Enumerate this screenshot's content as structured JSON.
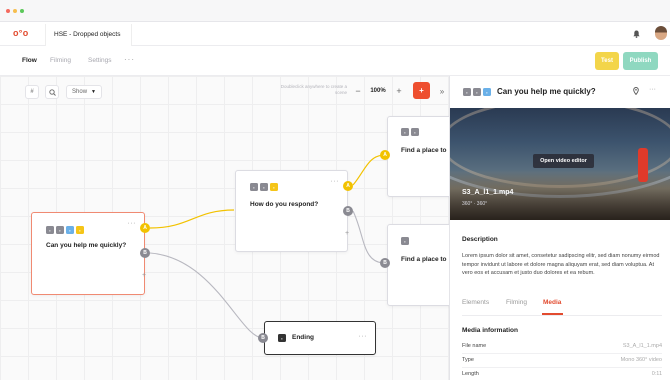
{
  "colors": {
    "brand": "#e24b2f",
    "connector_active": "#f2c200",
    "connector_default": "#b8b8c0",
    "test_button": "#f3d54a",
    "publish_button": "#8fd8c0"
  },
  "app": {
    "logo": "o°o",
    "document_tab": "HSE - Dropped objects"
  },
  "toolbar": {
    "tabs": [
      "Flow",
      "Filming",
      "Settings"
    ],
    "more": "···",
    "test_label": "Test",
    "publish_label": "Publish"
  },
  "canvas": {
    "hash_icon": "#",
    "search_icon": "🔍",
    "show_label": "Show",
    "hint": "Doubleclick anywhere to create a scene",
    "zoom_out": "−",
    "zoom_level": "100%",
    "zoom_in": "+",
    "add": "+",
    "collapse": "»"
  },
  "nodes": {
    "question1": {
      "title": "Can you help me quickly?",
      "dots": "···",
      "port_a": "A",
      "port_b": "B"
    },
    "question2": {
      "title": "How do you respond?",
      "dots": "···",
      "port_a": "A",
      "port_b": "B"
    },
    "place1": {
      "title": "Find a place to"
    },
    "place2": {
      "title": "Find a place to"
    },
    "ending": {
      "title": "Ending",
      "dots": "···"
    }
  },
  "connectors": {
    "a": "A",
    "b": "B",
    "add": "+"
  },
  "panel": {
    "title": "Can you help me quickly?",
    "pin_icon": "📍",
    "more": "···",
    "open_video_editor": "Open video editor",
    "file_title": "S3_A_l1_1.mp4",
    "file_sub": "360° · 360°",
    "description_heading": "Description",
    "description": "Lorem ipsum dolor sit amet, consetetur sadipscing elitr, sed diam nonumy eirmod tempor invidunt ut labore et dolore magna aliquyam erat, sed diam voluptua. At vero eos et accusam et justo duo dolores et ea rebum.",
    "tabs": [
      "Elements",
      "Filming",
      "Media"
    ],
    "media_info_heading": "Media information",
    "media_info": [
      {
        "key": "File name",
        "value": "S3_A_l1_1.mp4"
      },
      {
        "key": "Type",
        "value": "Mono 360° video"
      },
      {
        "key": "Length",
        "value": "0:11"
      }
    ]
  }
}
